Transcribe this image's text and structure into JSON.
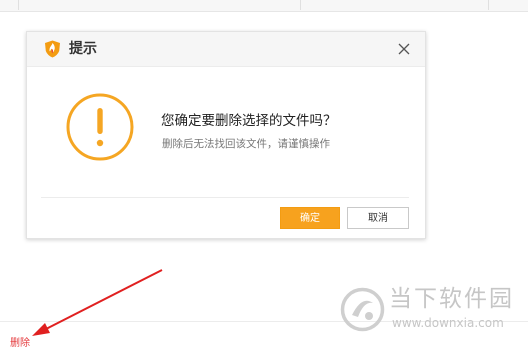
{
  "dialog": {
    "title": "提示",
    "question": "您确定要删除选择的文件吗？",
    "note": "删除后无法找回该文件，请谨慎操作",
    "confirm_label": "确定",
    "cancel_label": "取消",
    "icons": {
      "title": "shield-logo-icon",
      "close": "close-icon",
      "warning": "exclamation-warning-icon"
    }
  },
  "page": {
    "delete_link_label": "删除"
  },
  "watermark": {
    "brand": "当下软件园",
    "url": "www.downxia.com"
  },
  "colors": {
    "accent": "#f7a21e",
    "warning_ring": "#f5a623",
    "delete_link": "#e4393c",
    "annotation_arrow": "#e02020"
  }
}
